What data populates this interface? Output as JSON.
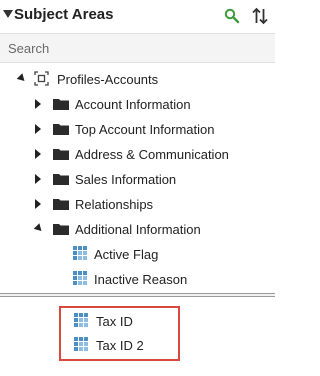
{
  "panel": {
    "title": "Subject Areas"
  },
  "search": {
    "placeholder": "Search",
    "value": ""
  },
  "tree": {
    "root": {
      "label": "Profiles-Accounts"
    },
    "folders": [
      {
        "label": "Account Information",
        "expanded": false
      },
      {
        "label": "Top Account Information",
        "expanded": false
      },
      {
        "label": "Address & Communication",
        "expanded": false
      },
      {
        "label": "Sales Information",
        "expanded": false
      },
      {
        "label": "Relationships",
        "expanded": false
      },
      {
        "label": "Additional Information",
        "expanded": true
      }
    ],
    "columns": [
      {
        "label": "Active Flag"
      },
      {
        "label": "Inactive Reason"
      }
    ]
  },
  "selected_columns": [
    {
      "label": "Tax ID"
    },
    {
      "label": "Tax ID 2"
    }
  ],
  "colors": {
    "search_icon": "#3c9a3c",
    "folder": "#2b2b2b",
    "column_icon": "#4b8fc4",
    "highlight_border": "#d9493d"
  }
}
